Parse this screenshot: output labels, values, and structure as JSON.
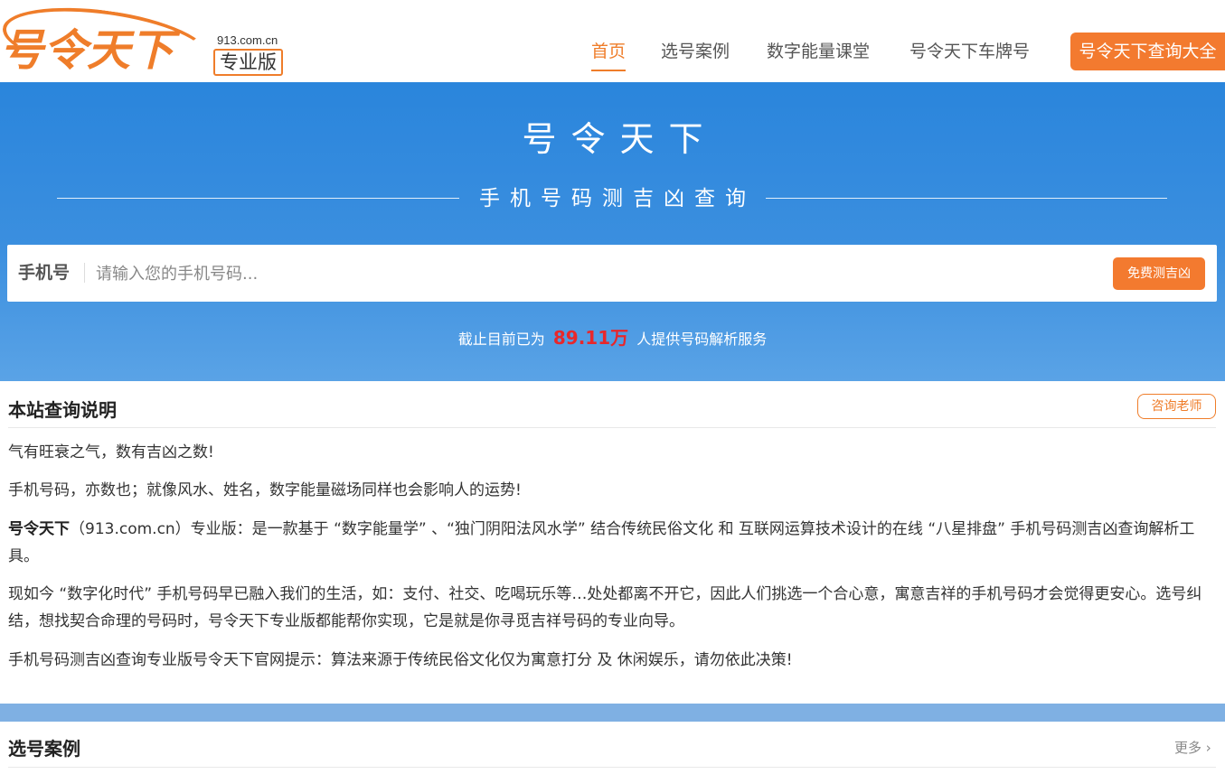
{
  "header": {
    "logo_text": "号令天下",
    "logo_domain": "913.com.cn",
    "logo_edition": "专业版",
    "nav": [
      {
        "label": "首页",
        "active": true
      },
      {
        "label": "选号案例",
        "active": false
      },
      {
        "label": "数字能量课堂",
        "active": false
      },
      {
        "label": "号令天下车牌号",
        "active": false
      }
    ],
    "nav_button": "号令天下查询大全"
  },
  "hero": {
    "title": "号令天下",
    "subtitle": "手机号码测吉凶查询",
    "search": {
      "label": "手机号",
      "placeholder": "请输入您的手机号码...",
      "value": "",
      "button": "免费测吉凶"
    },
    "stats": {
      "prefix": "截止目前已为",
      "number": "89.11万",
      "suffix": "人提供号码解析服务"
    }
  },
  "info": {
    "title": "本站查询说明",
    "consult_button": "咨询老师",
    "p1": "气有旺衰之气，数有吉凶之数!",
    "p2": "手机号码，亦数也；就像风水、姓名，数字能量磁场同样也会影响人的运势!",
    "p3_bold": "号令天下",
    "p3_rest": "（913.com.cn）专业版：是一款基于 “数字能量学” 、“独门阴阳法风水学” 结合传统民俗文化 和 互联网运算技术设计的在线 “八星排盘” 手机号码测吉凶查询解析工具。",
    "p4": "现如今 “数字化时代” 手机号码早已融入我们的生活，如：支付、社交、吃喝玩乐等…处处都离不开它，因此人们挑选一个合心意，寓意吉祥的手机号码才会觉得更安心。选号纠结，想找契合命理的号码时，号令天下专业版都能帮你实现，它是就是你寻觅吉祥号码的专业向导。",
    "p5": "手机号码测吉凶查询专业版号令天下官网提示：算法来源于传统民俗文化仅为寓意打分 及 休闲娱乐，请勿依此决策!"
  },
  "cases": {
    "title": "选号案例",
    "more": "更多",
    "more_icon": "chevron-right-icon"
  },
  "colors": {
    "accent": "#ef7d2a",
    "hero_blue": "#2a85dc",
    "stats_red": "#e8272b"
  }
}
